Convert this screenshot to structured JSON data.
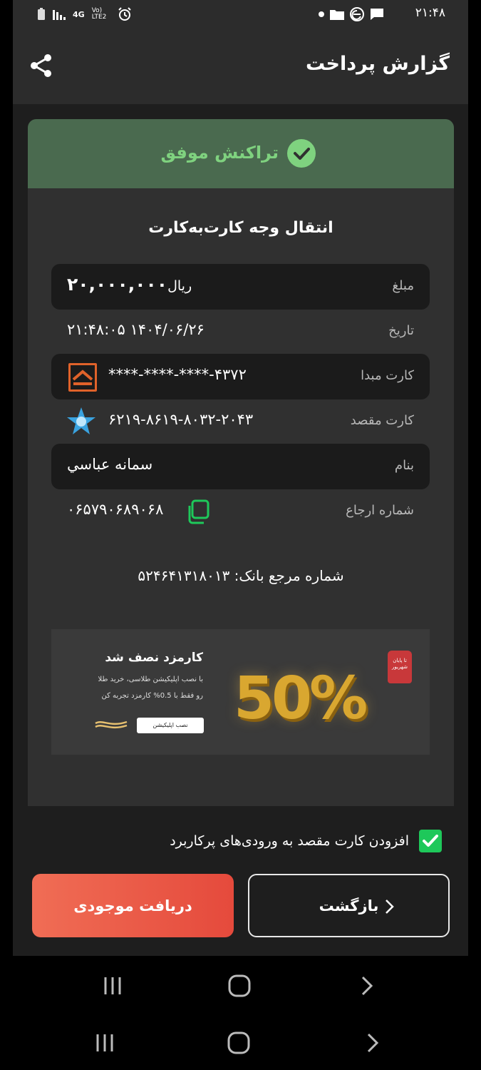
{
  "status_bar": {
    "time": "۲۱:۴۸",
    "network": "4G",
    "volte": "Vo) LTE2"
  },
  "header": {
    "title": "گزارش پرداخت"
  },
  "transaction": {
    "status": "تراکنش موفق",
    "title": "انتقال وجه کارت‌به‌کارت",
    "rows": [
      {
        "label": "مبلغ",
        "value": "۲۰,۰۰۰,۰۰۰",
        "unit": "ریال"
      },
      {
        "label": "تاریخ",
        "value": "۲۱:۴۸:۰۵ ۱۴۰۴/۰۶/۲۶"
      },
      {
        "label": "کارت مبدا",
        "value": "****-****-****-۴۳۷۲"
      },
      {
        "label": "کارت مقصد",
        "value": "۶۲۱۹-۸۶۱۹-۸۰۳۲-۲۰۴۳"
      },
      {
        "label": "بنام",
        "value": "سمانه عباسي"
      },
      {
        "label": "شماره ارجاع",
        "value": "۰۶۵۷۹۰۶۸۹۰۶۸"
      }
    ],
    "bank_ref": "شماره مرجع بانک: ۵۲۴۶۴۱۳۱۸۰۱۳"
  },
  "promo": {
    "title": "کارمزد نصف شد",
    "line1": "با نصب اپلیکیشن طلاسی، خرید طلا",
    "line2": "رو فقط با 0.5% کارمزد تجربه کن",
    "button": "نصب اپلیکیشن",
    "big_text": "50%",
    "tag": "تا پایان شهریور"
  },
  "checkbox": {
    "label": "افزودن کارت مقصد به ورودی‌های پرکاربرد",
    "checked": true
  },
  "buttons": {
    "balance": "دریافت موجودی",
    "back": "بازگشت"
  },
  "colors": {
    "success": "#7fd27f",
    "banner": "#4a6a4f",
    "accent_red": "#e54a3c",
    "checkbox_green": "#1ec85a"
  }
}
